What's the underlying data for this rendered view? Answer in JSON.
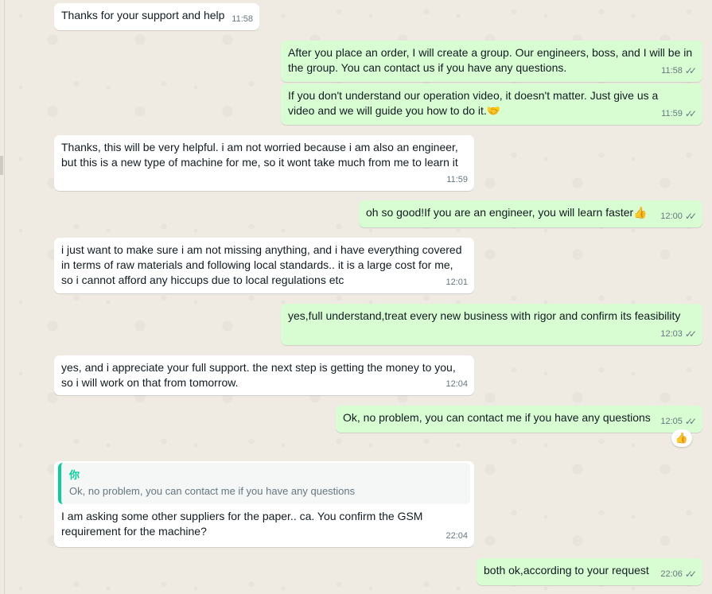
{
  "messages": [
    {
      "id": "m1",
      "dir": "in",
      "text": "Thanks for your support and help",
      "time": "11:58"
    },
    {
      "id": "m2",
      "dir": "out",
      "text": "After you place an order, I will create a group. Our engineers, boss, and I will be in\nthe group. You can contact us if you have any questions.",
      "time": "11:58",
      "status": "read"
    },
    {
      "id": "m3",
      "dir": "out",
      "text": "If you don't understand our operation video, it doesn't matter. Just give us a\nvideo and we will guide you how to do it.🤝",
      "time": "11:59",
      "status": "read"
    },
    {
      "id": "m4",
      "dir": "in",
      "text": "Thanks, this will be very helpful. i am not worried because i am also an engineer,\nbut this is a new type of machine for me, so it wont take much from me to learn it",
      "time": "11:59"
    },
    {
      "id": "m5",
      "dir": "out",
      "text": "oh so good!If you are an engineer, you will learn faster👍",
      "time": "12:00",
      "status": "read"
    },
    {
      "id": "m6",
      "dir": "in",
      "text": "i just want to make sure i am not missing anything, and i have everything covered\nin terms of raw materials and following local standards.. it is a large cost for me,\nso i cannot afford any hiccups due to local regulations etc",
      "time": "12:01"
    },
    {
      "id": "m7",
      "dir": "out",
      "text": "yes,full understand,treat every new business with rigor and confirm its feasibility",
      "time": "12:03",
      "status": "read"
    },
    {
      "id": "m8",
      "dir": "in",
      "text": "yes, and i appreciate your full support. the next step is getting the money to you,\nso i will work on that from tomorrow.",
      "time": "12:04"
    },
    {
      "id": "m9",
      "dir": "out",
      "text": "Ok, no problem, you can contact me if you have any questions",
      "time": "12:05",
      "status": "read",
      "reaction": "👍"
    },
    {
      "id": "m10",
      "dir": "in",
      "quote": {
        "author": "你",
        "text": "Ok, no problem, you can contact me if you have any questions"
      },
      "text": "I am asking some other suppliers for the paper.. ca. You confirm the GSM\nrequirement for the machine?",
      "time": "22:04"
    },
    {
      "id": "m11",
      "dir": "out",
      "text": "both ok,according to your request",
      "time": "22:06",
      "status": "read"
    }
  ],
  "icons": {
    "read_ticks": "double-check-icon"
  },
  "colors": {
    "incoming": "#ffffff",
    "outgoing": "#d9fdd3",
    "quote_accent": "#06cf9c",
    "wallpaper": "#efeae2"
  }
}
